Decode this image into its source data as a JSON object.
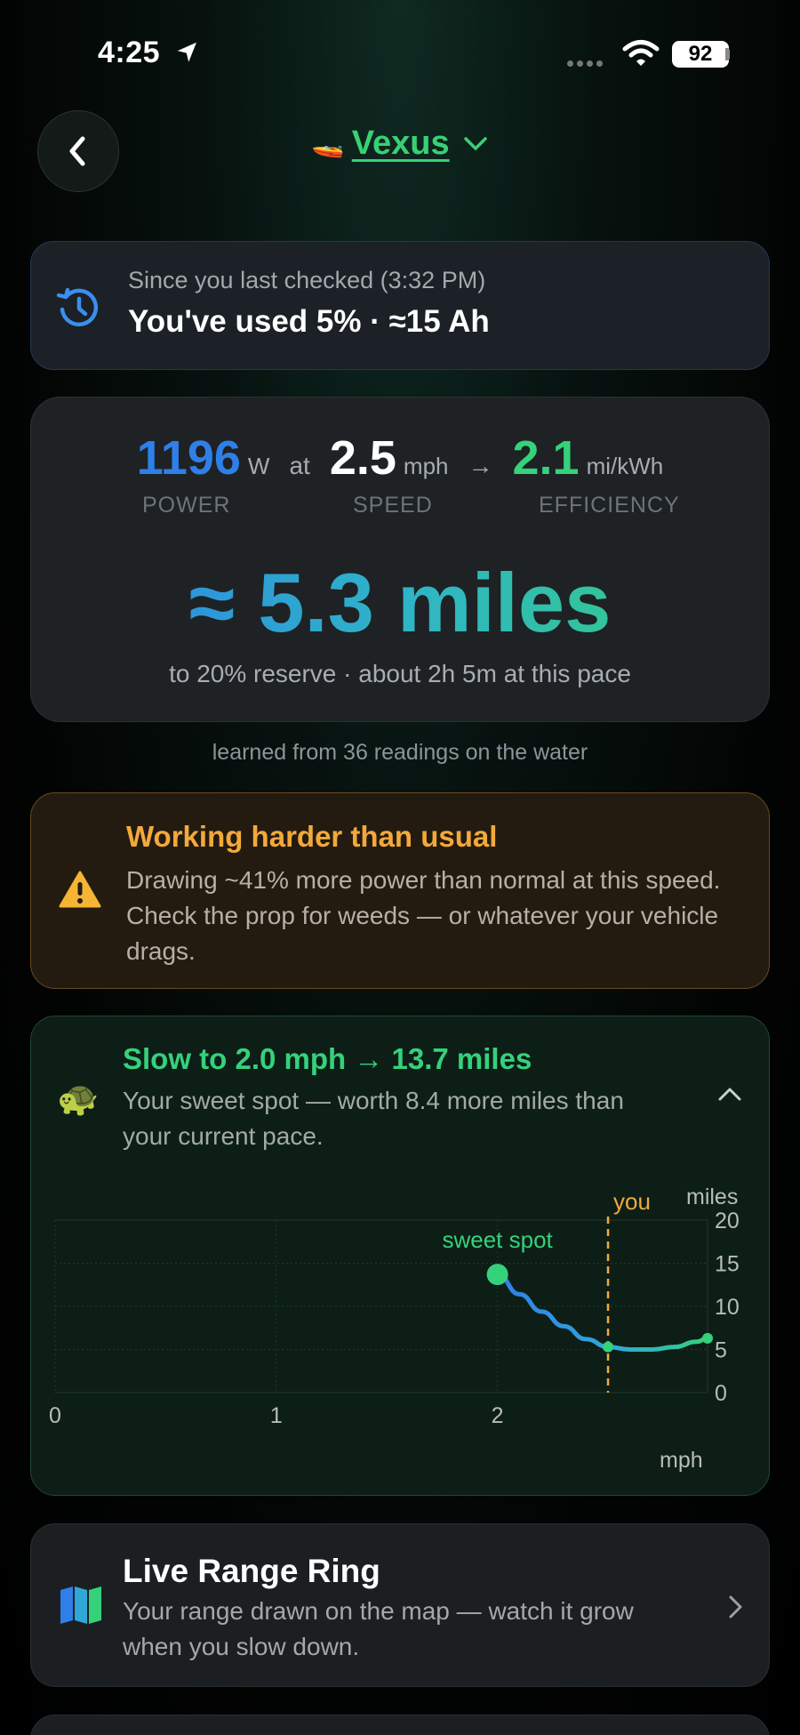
{
  "status": {
    "time": "4:25",
    "battery": "92"
  },
  "header": {
    "vehicle_emoji": "🚤",
    "vehicle_name": "Vexus"
  },
  "since": {
    "subtitle": "Since you last checked (3:32 PM)",
    "summary": "You've used 5% · ≈15 Ah"
  },
  "range": {
    "power_value": "1196",
    "power_unit": "W",
    "at_label": "at",
    "speed_value": "2.5",
    "speed_unit": "mph",
    "arrow": "→",
    "efficiency_value": "2.1",
    "efficiency_unit": "mi/kWh",
    "power_label": "POWER",
    "speed_label": "SPEED",
    "efficiency_label": "EFFICIENCY",
    "estimate": "≈ 5.3 miles",
    "detail": "to 20% reserve · about 2h 5m at this pace",
    "learned": "learned from 36 readings on the water",
    "colors": {
      "power": "#2f7fe9",
      "efficiency": "#35d17b"
    }
  },
  "warning": {
    "title": "Working harder than usual",
    "body": "Drawing ~41% more power than normal at this speed. Check the prop for weeds — or whatever your vehicle drags."
  },
  "sweet_spot": {
    "emoji": "🐢",
    "title": "Slow to 2.0 mph → 13.7 miles",
    "body": "Your sweet spot — worth 8.4 more miles than your current pace."
  },
  "chart_data": {
    "type": "line",
    "x_unit_label": "mph",
    "y_unit_label": "miles",
    "x_ticks": [
      "0",
      "1",
      "2"
    ],
    "y_ticks": [
      "20",
      "15",
      "10",
      "5",
      "0"
    ],
    "xlim": [
      0,
      2.95
    ],
    "ylim": [
      0,
      20
    ],
    "series": [
      {
        "x": [
          2.0,
          2.1,
          2.2,
          2.3,
          2.4,
          2.5,
          2.6,
          2.7,
          2.8,
          2.9,
          2.95
        ],
        "values": [
          13.7,
          11.4,
          9.4,
          7.7,
          6.2,
          5.3,
          5.0,
          5.0,
          5.3,
          5.9,
          6.3
        ]
      }
    ],
    "annotations": [
      {
        "label": "sweet spot",
        "x": 2.0,
        "y": 13.7
      },
      {
        "label": "you",
        "x": 2.5,
        "y": 5.3
      }
    ],
    "grid": true
  },
  "live_range": {
    "title": "Live Range Ring",
    "body": "Your range drawn on the map — watch it grow when you slow down."
  }
}
